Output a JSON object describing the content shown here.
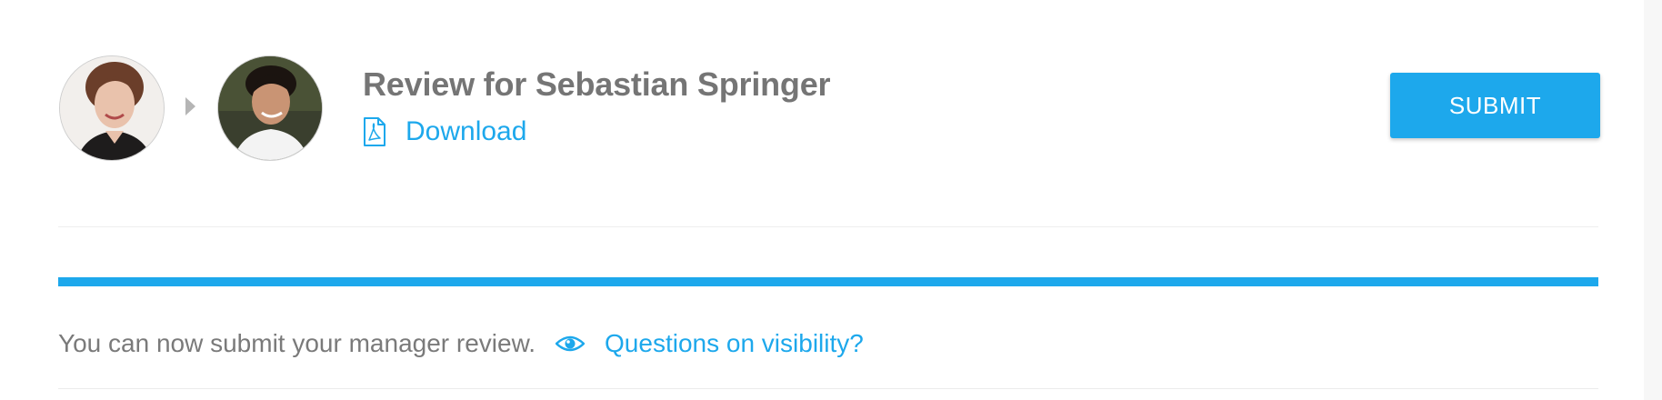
{
  "review": {
    "title": "Review for Sebastian Springer",
    "download_label": "Download",
    "submit_label": "SUBMIT"
  },
  "avatars": {
    "manager_icon": "person-photo-icon",
    "employee_icon": "person-photo-icon",
    "separator_icon": "caret-right-icon"
  },
  "progress": {
    "fraction": 1.0
  },
  "status": {
    "message": "You can now submit your manager review.",
    "visibility_link": "Questions on visibility?"
  },
  "colors": {
    "accent": "#1da8ec",
    "title": "#757575",
    "body_text": "#7a7a7a",
    "button_text": "#ffffff"
  }
}
